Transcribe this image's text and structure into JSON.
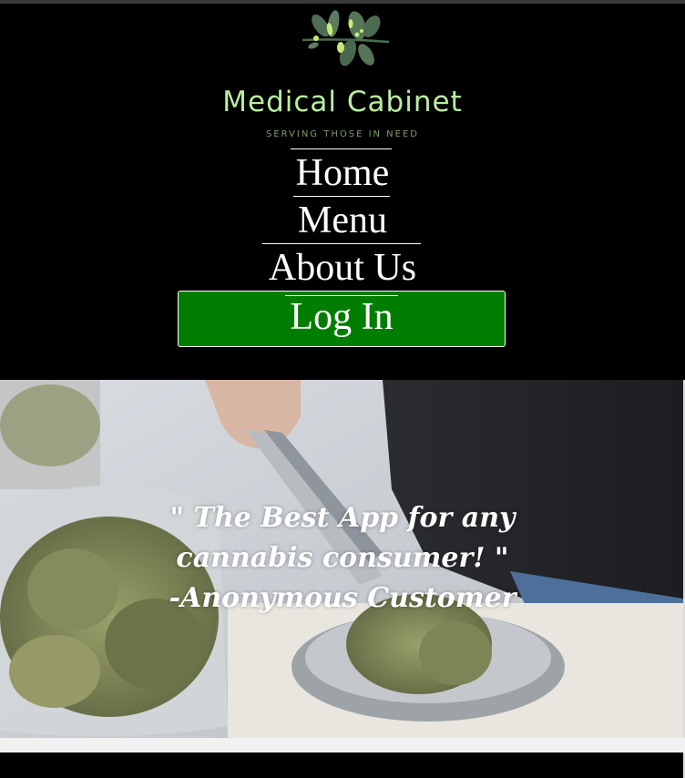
{
  "brand": {
    "title": "Medical Cabinet",
    "tagline": "SERVING THOSE IN NEED",
    "logo_icon": "leaf-branch-icon",
    "title_color": "#b9eea0"
  },
  "nav": {
    "home": "Home",
    "menu": "Menu",
    "about": "About Us",
    "login": "Log In",
    "login_color": "#017e01"
  },
  "hero": {
    "image_subject": "cannabis-weighing-photo",
    "quote_line1": "\" The Best App for any",
    "quote_line2": "cannabis consumer! \"",
    "quote_line3": "-Anonymous Customer"
  }
}
